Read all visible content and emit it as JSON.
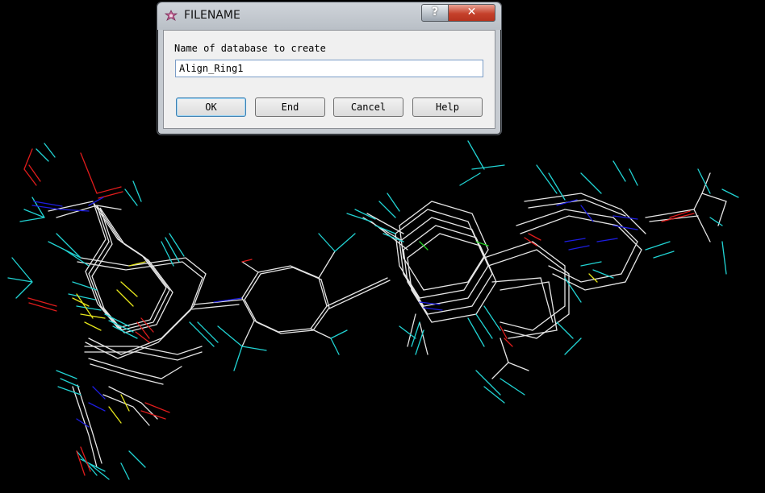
{
  "dialog": {
    "title": "FILENAME",
    "caption_help": "?",
    "caption_close": "✕",
    "prompt": "Name of database to create",
    "input_value": "Align_Ring1",
    "buttons": {
      "ok": "OK",
      "end": "End",
      "cancel": "Cancel",
      "help": "Help"
    }
  },
  "colors": {
    "background": "#000000",
    "bond_carbon": "#e6e6e6",
    "hydrogen": "#21d3d3",
    "nitrogen": "#1d1de0",
    "oxygen": "#e01c1c",
    "sulfur": "#e6e61c",
    "halogen": "#20d020"
  }
}
